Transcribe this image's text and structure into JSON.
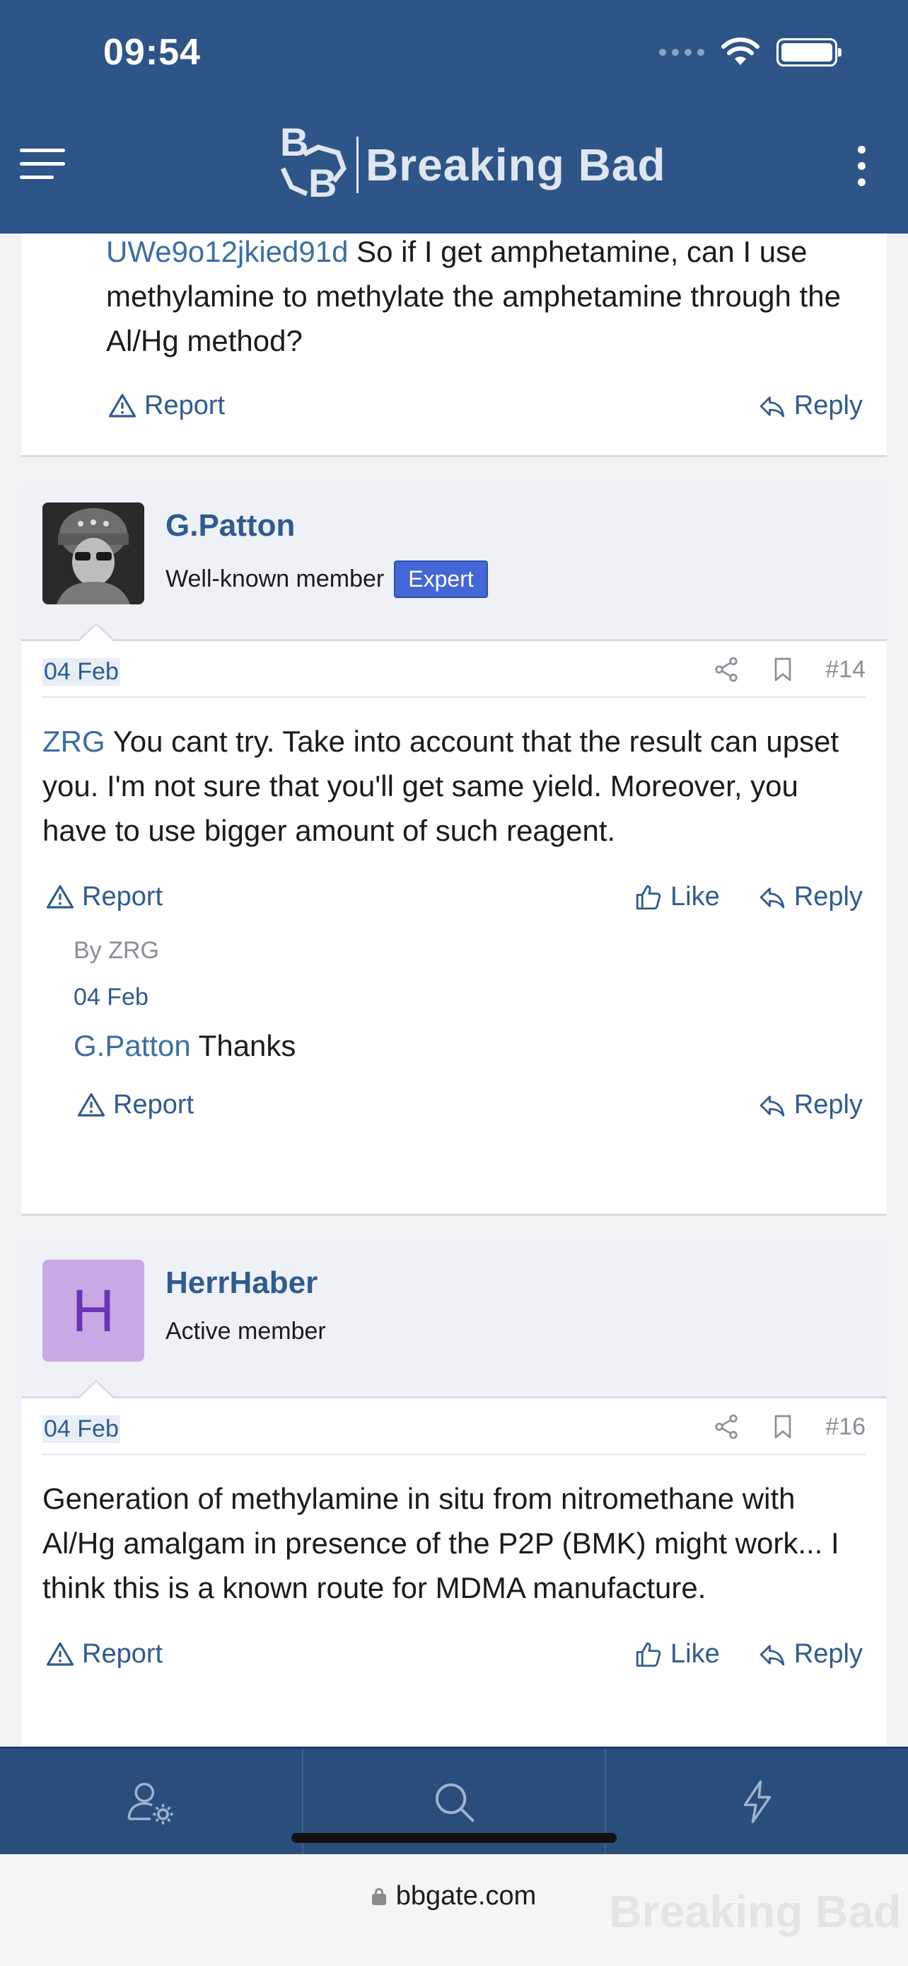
{
  "status_bar": {
    "time": "09:54"
  },
  "header": {
    "site_name": "Breaking Bad",
    "logo_letters": [
      "B",
      "B"
    ]
  },
  "previous_post": {
    "mention": "UWe9o12jkied91d",
    "text": " So if I get amphetamine, can I use methylamine to methylate the amphetamine through the Al/Hg method?",
    "report_label": "Report",
    "reply_label": "Reply"
  },
  "post_14": {
    "username": "G.Patton",
    "user_title": "Well-known member",
    "badge": "Expert",
    "date": "04 Feb",
    "number": "#14",
    "mention": "ZRG",
    "text": " You cant try. Take into account that the result can upset you. I'm not sure that you'll get same yield. Moreover, you have to use bigger amount of such reagent.",
    "report_label": "Report",
    "like_label": "Like",
    "reply_label": "Reply",
    "comment": {
      "by": "By ZRG",
      "date": "04 Feb",
      "mention": "G.Patton",
      "text": " Thanks",
      "report_label": "Report",
      "reply_label": "Reply"
    }
  },
  "post_16": {
    "avatar_letter": "H",
    "avatar_bg": "#c9a8e6",
    "avatar_fg": "#6a34b3",
    "username": "HerrHaber",
    "user_title": "Active member",
    "date": "04 Feb",
    "number": "#16",
    "text": "Generation of methylamine in situ from nitromethane with Al/Hg amalgam in presence of the P2P (BMK) might work... I think this is a known route for MDMA manufacture.",
    "report_label": "Report",
    "like_label": "Like",
    "reply_label": "Reply"
  },
  "bottom_nav": {
    "icons": [
      "user-settings-icon",
      "search-icon",
      "lightning-icon"
    ]
  },
  "browser": {
    "url": "bbgate.com",
    "watermark": "Breaking Bad"
  },
  "colors": {
    "header_bg": "#2d5587",
    "link": "#3a6ea5",
    "badge": "#4367d6"
  }
}
